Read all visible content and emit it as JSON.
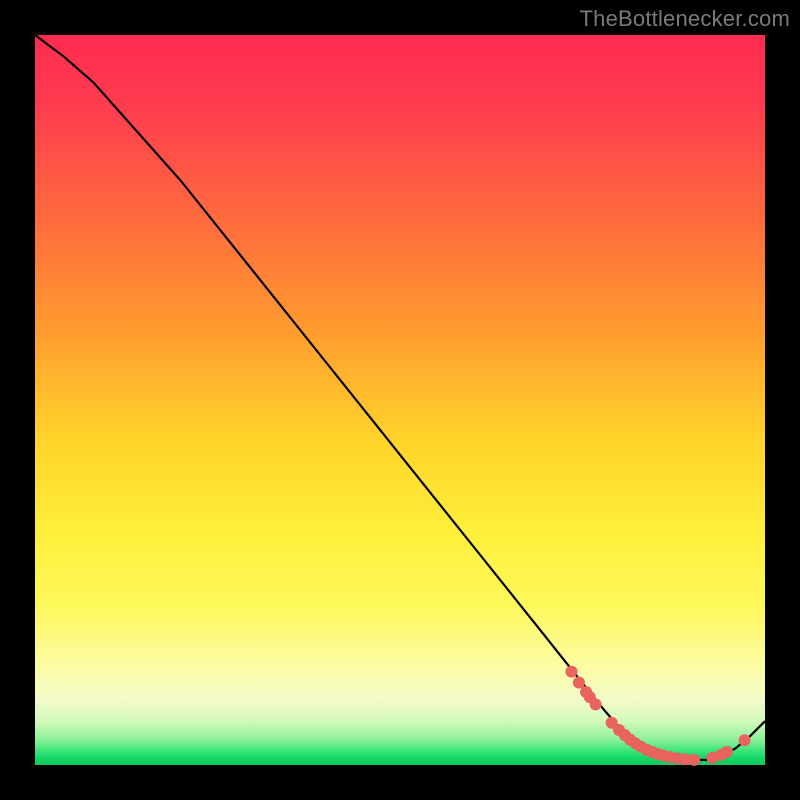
{
  "watermark": "TheBottlenecker.com",
  "chart_data": {
    "type": "line",
    "title": "",
    "xlabel": "",
    "ylabel": "",
    "xlim": [
      0,
      100
    ],
    "ylim": [
      0,
      100
    ],
    "series": [
      {
        "name": "curve",
        "x": [
          0,
          4,
          8,
          12,
          20,
          30,
          40,
          50,
          60,
          70,
          75,
          78,
          80,
          82,
          84,
          86,
          88,
          90,
          92,
          94,
          96,
          98,
          100
        ],
        "y": [
          100,
          97,
          93.5,
          89,
          80,
          67.5,
          55,
          42.5,
          30,
          17.5,
          11.2,
          7.5,
          5.2,
          3.5,
          2.3,
          1.5,
          1.0,
          0.7,
          0.7,
          1.2,
          2.3,
          4.0,
          6.0
        ]
      }
    ],
    "markers": {
      "name": "highlight-dots",
      "x": [
        73.5,
        74.5,
        75.5,
        76.0,
        76.8,
        79.0,
        80.0,
        80.8,
        81.5,
        82.2,
        83.0,
        83.8,
        84.5,
        85.3,
        86.1,
        87.0,
        88.0,
        89.1,
        90.3,
        92.8,
        94.0,
        94.8,
        97.2
      ],
      "y": [
        12.8,
        11.3,
        10.0,
        9.3,
        8.3,
        5.8,
        4.8,
        4.1,
        3.5,
        3.0,
        2.5,
        2.1,
        1.8,
        1.5,
        1.3,
        1.1,
        0.9,
        0.8,
        0.7,
        1.0,
        1.4,
        1.8,
        3.4
      ]
    },
    "colors": {
      "curve": "#000000",
      "marker": "#e9635f",
      "gradient_top": "#ff2b52",
      "gradient_mid": "#ffef3a",
      "gradient_bottom": "#0fc95f"
    }
  }
}
